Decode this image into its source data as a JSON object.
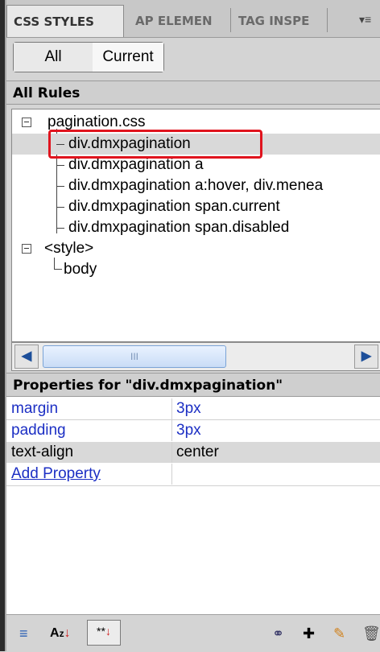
{
  "tabs": [
    {
      "label": "CSS STYLES"
    },
    {
      "label": "AP ELEMEN"
    },
    {
      "label": "TAG INSPE"
    }
  ],
  "toggle": {
    "all": "All",
    "current": "Current"
  },
  "rules": {
    "header": "All Rules",
    "tree": [
      {
        "label": "pagination.css"
      },
      {
        "label": "div.dmxpagination"
      },
      {
        "label": "div.dmxpagination a"
      },
      {
        "label": "div.dmxpagination a:hover, div.menea"
      },
      {
        "label": "div.dmxpagination span.current"
      },
      {
        "label": "div.dmxpagination span.disabled"
      },
      {
        "label": "<style>"
      },
      {
        "label": "body"
      }
    ],
    "selected": "div.dmxpagination"
  },
  "properties": {
    "header": "Properties for \"div.dmxpagination\"",
    "rows": [
      {
        "name": "margin",
        "value": "3px"
      },
      {
        "name": "padding",
        "value": "3px"
      },
      {
        "name": "text-align",
        "value": "center"
      }
    ],
    "add_label": "Add Property"
  },
  "scrollbar": {
    "thumb_grip": "III"
  },
  "icons": {
    "panel_menu": "panel-menu-icon",
    "category_view": "category-view-icon",
    "alpha_view": "alphabetical-view-icon",
    "set_props_view": "set-properties-view-icon",
    "attach_stylesheet": "attach-stylesheet-icon",
    "new_rule": "new-css-rule-icon",
    "edit_rule": "edit-rule-icon",
    "delete_rule": "delete-rule-icon"
  },
  "colors": {
    "highlight": "#e0141e",
    "link": "#1c2fc4"
  }
}
